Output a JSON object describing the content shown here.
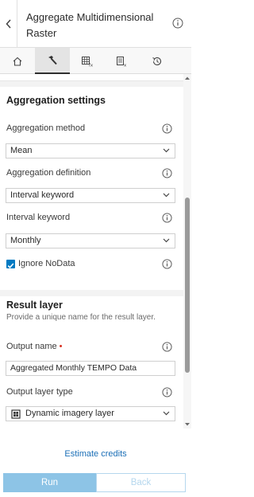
{
  "header": {
    "title": "Aggregate Multidimensional Raster",
    "back_icon": "chevron-left-icon",
    "info_icon": "info-icon"
  },
  "tabs": [
    {
      "icon": "home-icon",
      "active": false
    },
    {
      "icon": "hammer-icon",
      "active": true
    },
    {
      "icon": "raster-function-icon",
      "active": false
    },
    {
      "icon": "raster-function-template-icon",
      "active": false
    },
    {
      "icon": "history-icon",
      "active": false
    }
  ],
  "aggregation": {
    "title": "Aggregation settings",
    "method_label": "Aggregation method",
    "method_value": "Mean",
    "definition_label": "Aggregation definition",
    "definition_value": "Interval keyword",
    "interval_label": "Interval keyword",
    "interval_value": "Monthly",
    "ignore_nodata_label": "Ignore NoData",
    "ignore_nodata_checked": true
  },
  "result": {
    "title": "Result layer",
    "description": "Provide a unique name for the result layer.",
    "output_name_label": "Output name",
    "required_marker": "•",
    "output_name_value": "Aggregated Monthly TEMPO Data",
    "output_type_label": "Output layer type",
    "output_type_value": "Dynamic imagery layer"
  },
  "footer": {
    "estimate_label": "Estimate credits",
    "run_label": "Run",
    "back_label": "Back"
  },
  "colors": {
    "accent": "#007ac2",
    "run_bg": "#8dc4e6",
    "link": "#1b6fb7",
    "required": "#d83020"
  }
}
